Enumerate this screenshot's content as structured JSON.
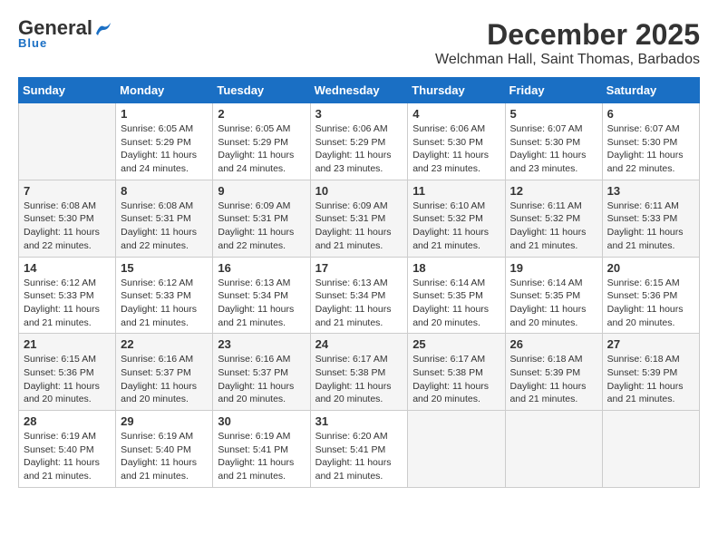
{
  "header": {
    "logo_general": "General",
    "logo_blue": "Blue",
    "main_title": "December 2025",
    "subtitle": "Welchman Hall, Saint Thomas, Barbados"
  },
  "calendar": {
    "days_of_week": [
      "Sunday",
      "Monday",
      "Tuesday",
      "Wednesday",
      "Thursday",
      "Friday",
      "Saturday"
    ],
    "weeks": [
      [
        {
          "day": "",
          "info": ""
        },
        {
          "day": "1",
          "info": "Sunrise: 6:05 AM\nSunset: 5:29 PM\nDaylight: 11 hours\nand 24 minutes."
        },
        {
          "day": "2",
          "info": "Sunrise: 6:05 AM\nSunset: 5:29 PM\nDaylight: 11 hours\nand 24 minutes."
        },
        {
          "day": "3",
          "info": "Sunrise: 6:06 AM\nSunset: 5:29 PM\nDaylight: 11 hours\nand 23 minutes."
        },
        {
          "day": "4",
          "info": "Sunrise: 6:06 AM\nSunset: 5:30 PM\nDaylight: 11 hours\nand 23 minutes."
        },
        {
          "day": "5",
          "info": "Sunrise: 6:07 AM\nSunset: 5:30 PM\nDaylight: 11 hours\nand 23 minutes."
        },
        {
          "day": "6",
          "info": "Sunrise: 6:07 AM\nSunset: 5:30 PM\nDaylight: 11 hours\nand 22 minutes."
        }
      ],
      [
        {
          "day": "7",
          "info": "Sunrise: 6:08 AM\nSunset: 5:30 PM\nDaylight: 11 hours\nand 22 minutes."
        },
        {
          "day": "8",
          "info": "Sunrise: 6:08 AM\nSunset: 5:31 PM\nDaylight: 11 hours\nand 22 minutes."
        },
        {
          "day": "9",
          "info": "Sunrise: 6:09 AM\nSunset: 5:31 PM\nDaylight: 11 hours\nand 22 minutes."
        },
        {
          "day": "10",
          "info": "Sunrise: 6:09 AM\nSunset: 5:31 PM\nDaylight: 11 hours\nand 21 minutes."
        },
        {
          "day": "11",
          "info": "Sunrise: 6:10 AM\nSunset: 5:32 PM\nDaylight: 11 hours\nand 21 minutes."
        },
        {
          "day": "12",
          "info": "Sunrise: 6:11 AM\nSunset: 5:32 PM\nDaylight: 11 hours\nand 21 minutes."
        },
        {
          "day": "13",
          "info": "Sunrise: 6:11 AM\nSunset: 5:33 PM\nDaylight: 11 hours\nand 21 minutes."
        }
      ],
      [
        {
          "day": "14",
          "info": "Sunrise: 6:12 AM\nSunset: 5:33 PM\nDaylight: 11 hours\nand 21 minutes."
        },
        {
          "day": "15",
          "info": "Sunrise: 6:12 AM\nSunset: 5:33 PM\nDaylight: 11 hours\nand 21 minutes."
        },
        {
          "day": "16",
          "info": "Sunrise: 6:13 AM\nSunset: 5:34 PM\nDaylight: 11 hours\nand 21 minutes."
        },
        {
          "day": "17",
          "info": "Sunrise: 6:13 AM\nSunset: 5:34 PM\nDaylight: 11 hours\nand 21 minutes."
        },
        {
          "day": "18",
          "info": "Sunrise: 6:14 AM\nSunset: 5:35 PM\nDaylight: 11 hours\nand 20 minutes."
        },
        {
          "day": "19",
          "info": "Sunrise: 6:14 AM\nSunset: 5:35 PM\nDaylight: 11 hours\nand 20 minutes."
        },
        {
          "day": "20",
          "info": "Sunrise: 6:15 AM\nSunset: 5:36 PM\nDaylight: 11 hours\nand 20 minutes."
        }
      ],
      [
        {
          "day": "21",
          "info": "Sunrise: 6:15 AM\nSunset: 5:36 PM\nDaylight: 11 hours\nand 20 minutes."
        },
        {
          "day": "22",
          "info": "Sunrise: 6:16 AM\nSunset: 5:37 PM\nDaylight: 11 hours\nand 20 minutes."
        },
        {
          "day": "23",
          "info": "Sunrise: 6:16 AM\nSunset: 5:37 PM\nDaylight: 11 hours\nand 20 minutes."
        },
        {
          "day": "24",
          "info": "Sunrise: 6:17 AM\nSunset: 5:38 PM\nDaylight: 11 hours\nand 20 minutes."
        },
        {
          "day": "25",
          "info": "Sunrise: 6:17 AM\nSunset: 5:38 PM\nDaylight: 11 hours\nand 20 minutes."
        },
        {
          "day": "26",
          "info": "Sunrise: 6:18 AM\nSunset: 5:39 PM\nDaylight: 11 hours\nand 21 minutes."
        },
        {
          "day": "27",
          "info": "Sunrise: 6:18 AM\nSunset: 5:39 PM\nDaylight: 11 hours\nand 21 minutes."
        }
      ],
      [
        {
          "day": "28",
          "info": "Sunrise: 6:19 AM\nSunset: 5:40 PM\nDaylight: 11 hours\nand 21 minutes."
        },
        {
          "day": "29",
          "info": "Sunrise: 6:19 AM\nSunset: 5:40 PM\nDaylight: 11 hours\nand 21 minutes."
        },
        {
          "day": "30",
          "info": "Sunrise: 6:19 AM\nSunset: 5:41 PM\nDaylight: 11 hours\nand 21 minutes."
        },
        {
          "day": "31",
          "info": "Sunrise: 6:20 AM\nSunset: 5:41 PM\nDaylight: 11 hours\nand 21 minutes."
        },
        {
          "day": "",
          "info": ""
        },
        {
          "day": "",
          "info": ""
        },
        {
          "day": "",
          "info": ""
        }
      ]
    ]
  }
}
